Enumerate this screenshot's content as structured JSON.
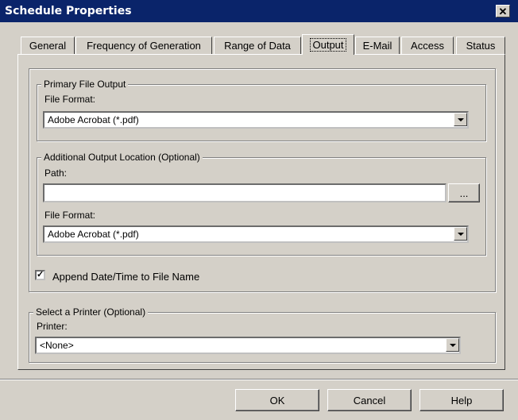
{
  "window": {
    "title": "Schedule Properties",
    "close_glyph": "✕"
  },
  "tabs": [
    {
      "label": "General"
    },
    {
      "label": "Frequency of Generation"
    },
    {
      "label": "Range of Data"
    },
    {
      "label": "Output"
    },
    {
      "label": "E-Mail"
    },
    {
      "label": "Access"
    },
    {
      "label": "Status"
    }
  ],
  "primary": {
    "legend": "Primary File Output",
    "file_format_label": "File Format:",
    "file_format_value": "Adobe Acrobat (*.pdf)"
  },
  "additional": {
    "legend": "Additional Output Location (Optional)",
    "path_label": "Path:",
    "path_value": "",
    "browse_label": "...",
    "file_format_label": "File Format:",
    "file_format_value": "Adobe Acrobat (*.pdf)"
  },
  "append": {
    "label": "Append Date/Time to File Name",
    "checked": true,
    "check_glyph": "✓"
  },
  "printer": {
    "legend": "Select a Printer (Optional)",
    "printer_label": "Printer:",
    "printer_value": "<None>"
  },
  "buttons": {
    "ok": "OK",
    "cancel": "Cancel",
    "help": "Help"
  }
}
